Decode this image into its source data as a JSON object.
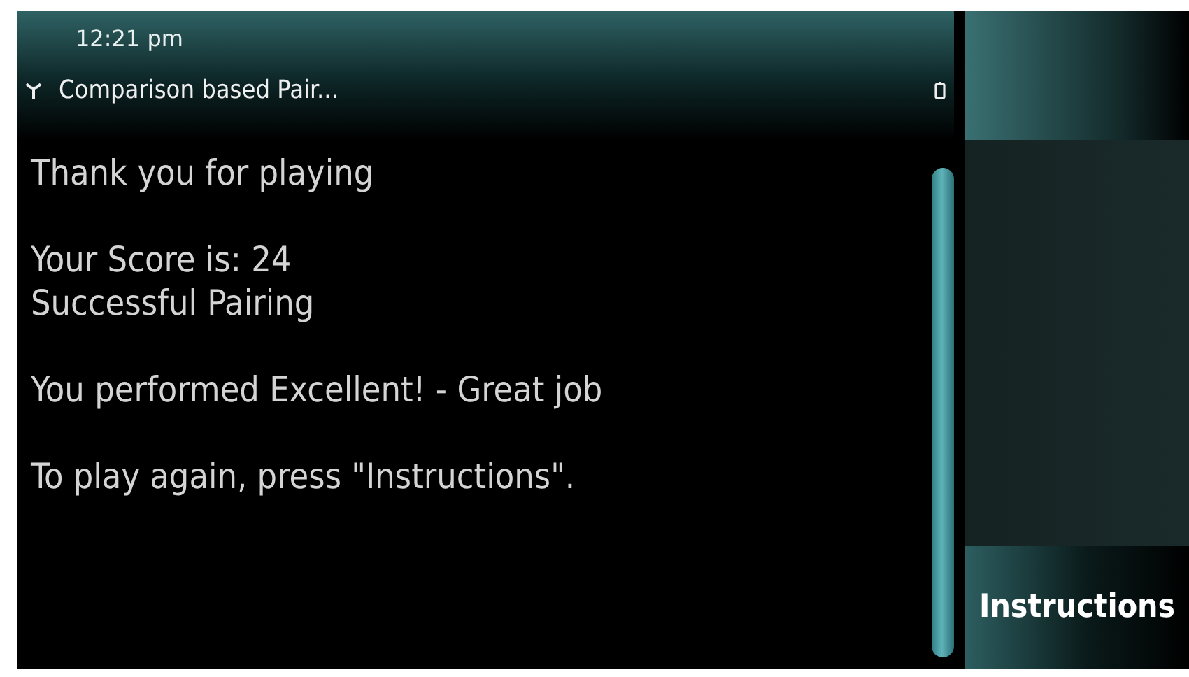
{
  "status_bar": {
    "time": "12:21 pm"
  },
  "title_bar": {
    "title": "Comparison based Pair..."
  },
  "content": {
    "paragraphs": [
      [
        "Thank you for playing"
      ],
      [
        "Your Score is: 24",
        "Successful Pairing"
      ],
      [
        "You performed Excellent! - Great job"
      ],
      [
        "To play again, press \"Instructions\"."
      ]
    ]
  },
  "softkeys": [
    {
      "label": "Instructions"
    }
  ]
}
